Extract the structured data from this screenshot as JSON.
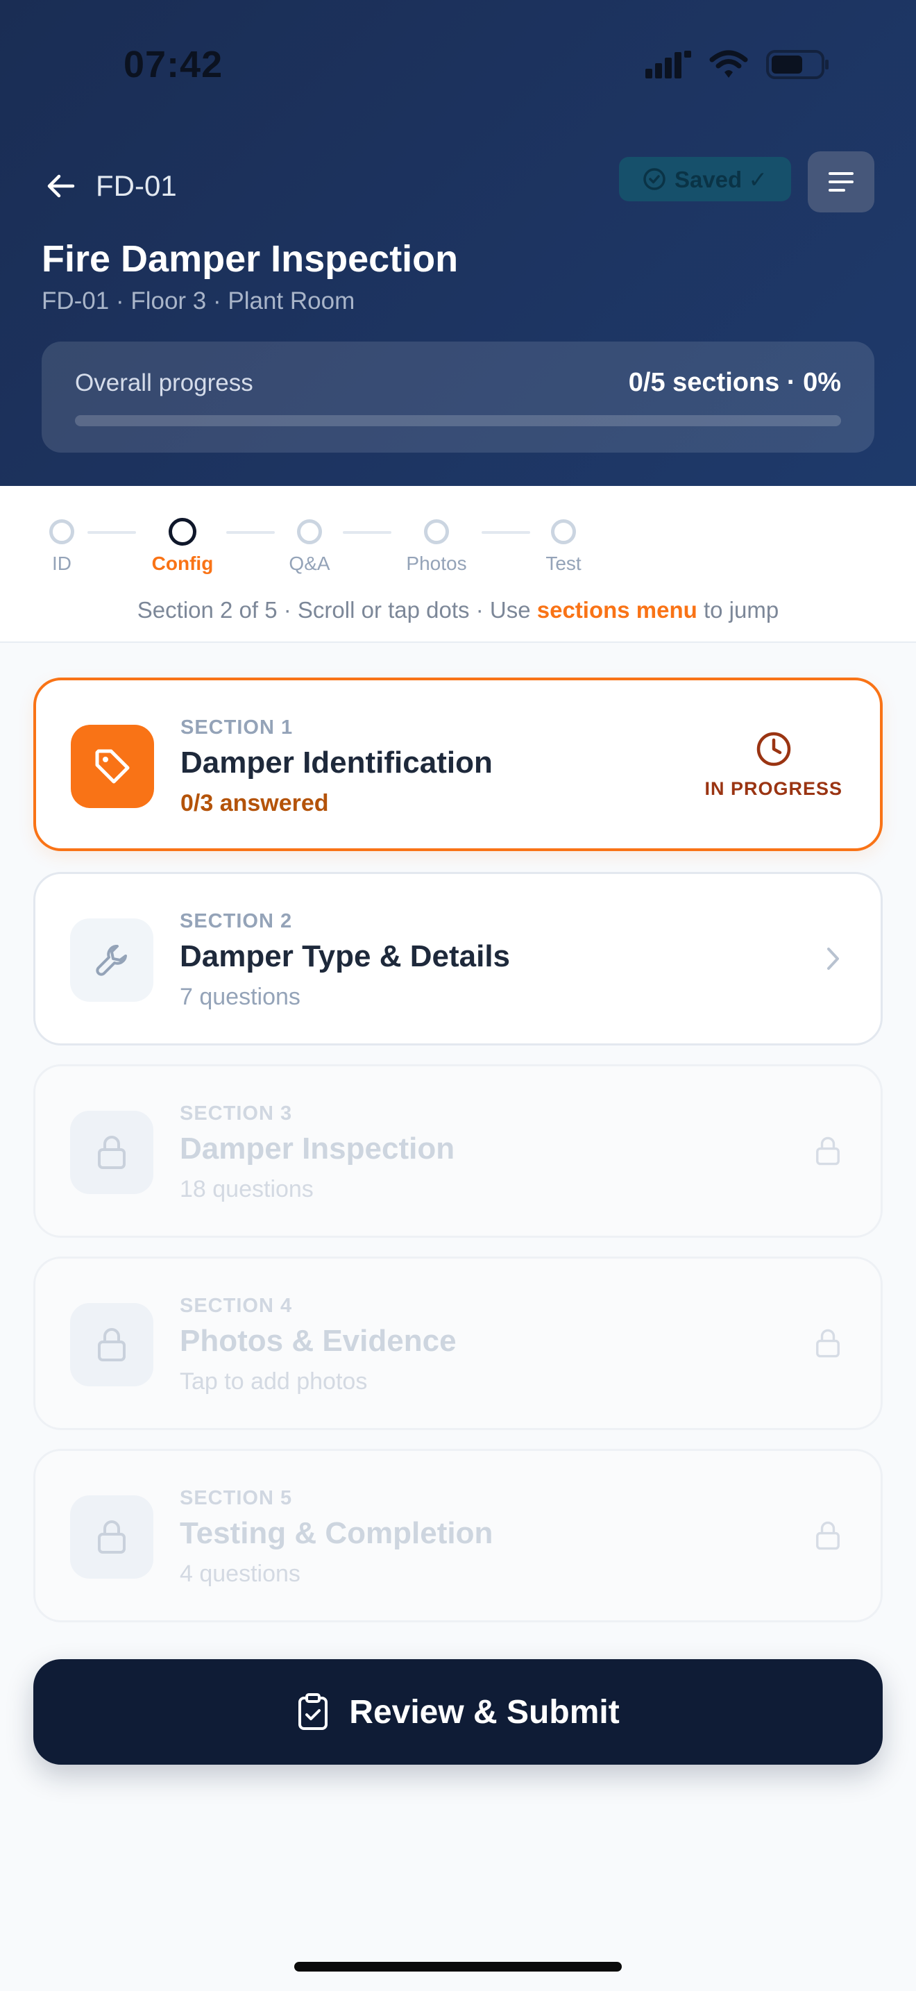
{
  "status_bar": {
    "time": "07:42"
  },
  "nav": {
    "title": "FD-01",
    "saved_label": "Saved ✓"
  },
  "header": {
    "title": "Fire Damper Inspection",
    "subtitle": "FD-01 · Floor 3 · Plant Room"
  },
  "progress": {
    "label": "Overall progress",
    "value_text": "0/5 sections · 0%",
    "completed_sections": 0,
    "total_sections": 5,
    "percent": 0
  },
  "stepper": {
    "steps": [
      {
        "label": "ID",
        "active": false
      },
      {
        "label": "Config",
        "active": true
      },
      {
        "label": "Q&A",
        "active": false
      },
      {
        "label": "Photos",
        "active": false
      },
      {
        "label": "Test",
        "active": false
      }
    ],
    "hint_prefix": "Section 2 of 5 · Scroll or tap dots · Use",
    "hint_link": "sections menu",
    "hint_suffix": "to jump"
  },
  "sections": [
    {
      "number_label": "SECTION 1",
      "title": "Damper Identification",
      "subtitle": "0/3 answered",
      "state": "in-progress",
      "status_label": "IN PROGRESS",
      "icon": "tag-icon"
    },
    {
      "number_label": "SECTION 2",
      "title": "Damper Type & Details",
      "subtitle": "7 questions",
      "state": "available",
      "icon": "wrench-icon"
    },
    {
      "number_label": "SECTION 3",
      "title": "Damper Inspection",
      "subtitle": "18 questions",
      "state": "locked",
      "icon": "lock-icon"
    },
    {
      "number_label": "SECTION 4",
      "title": "Photos & Evidence",
      "subtitle": "Tap to add photos",
      "state": "locked",
      "icon": "lock-icon"
    },
    {
      "number_label": "SECTION 5",
      "title": "Testing & Completion",
      "subtitle": "4 questions",
      "state": "locked",
      "icon": "lock-icon"
    }
  ],
  "submit": {
    "label": "Review & Submit",
    "icon": "clipboard-check-icon"
  },
  "colors": {
    "accent": "#f97316",
    "header_bg": "#1d3461",
    "submit_bg": "#0f1c36"
  }
}
